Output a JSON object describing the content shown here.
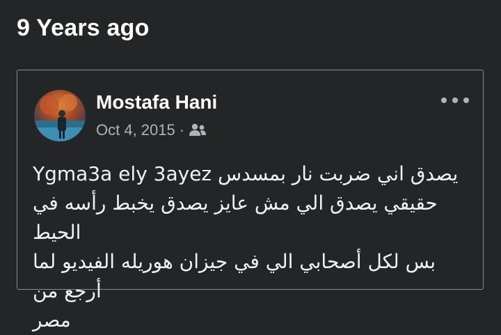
{
  "section": {
    "title": "9 Years ago"
  },
  "post": {
    "author": "Mostafa Hani",
    "date": "Oct 4, 2015",
    "separator": "·",
    "privacy_icon": "friends-icon",
    "more_icon": "more-options-icon",
    "body": "يصدق اني ضربت نار بمسدس Ygma3a ely 3ayez\nحقيقي يصدق الي مش عايز يصدق يخبط رأسه في الحيط\nبس لكل أصحابي الي في جيزان هوريله الفيديو لما أرجع من\nمصر"
  },
  "colors": {
    "background": "#242526",
    "border": "#8a8d91",
    "text": "#e4e6eb",
    "muted": "#b0b3b8"
  }
}
